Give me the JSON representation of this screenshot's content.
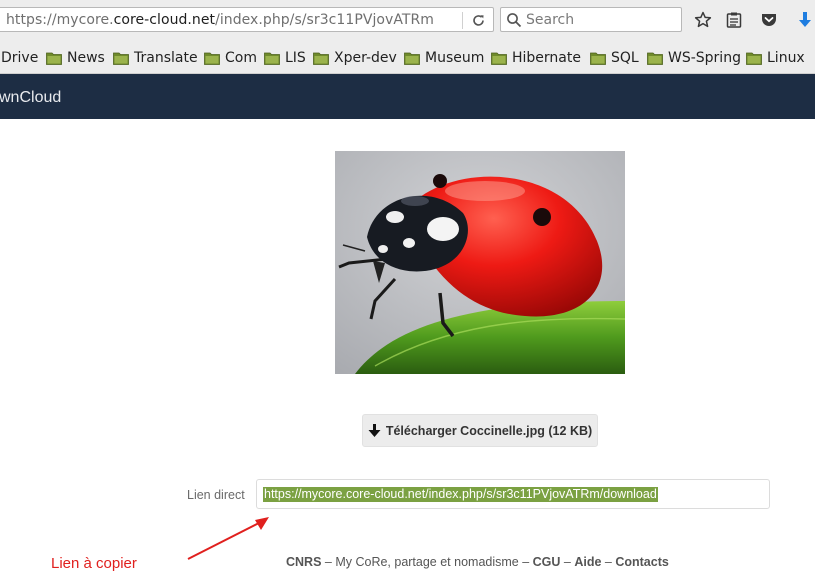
{
  "browser": {
    "url_prefix": "https://mycore.",
    "url_host": "core-cloud.net",
    "url_path": "/index.php/s/sr3c11PVjovATRm",
    "search_placeholder": "Search"
  },
  "bookmarks": [
    "Drive",
    "News",
    "Translate",
    "Com",
    "LIS",
    "Xper-dev",
    "Museum",
    "Hibernate",
    "SQL",
    "WS-Spring",
    "Linux"
  ],
  "app": {
    "title": "wnCloud"
  },
  "download": {
    "label": "Télécharger Coccinelle.jpg (12 KB)"
  },
  "direct_link": {
    "label": "Lien direct",
    "value": "https://mycore.core-cloud.net/index.php/s/sr3c11PVjovATRm/download"
  },
  "annotation": {
    "text": "Lien à copier"
  },
  "footer": {
    "org": "CNRS",
    "sep1": " – ",
    "tagline": "My CoRe, partage et nomadisme",
    "sep2": " – ",
    "cgu": "CGU",
    "sep3": " – ",
    "aide": "Aide",
    "sep4": " – ",
    "contacts": "Contacts"
  },
  "colors": {
    "header_bg": "#1d2d44",
    "selection": "#7ba142",
    "annotation": "#e0201e",
    "folder": "#6f8a2b"
  }
}
